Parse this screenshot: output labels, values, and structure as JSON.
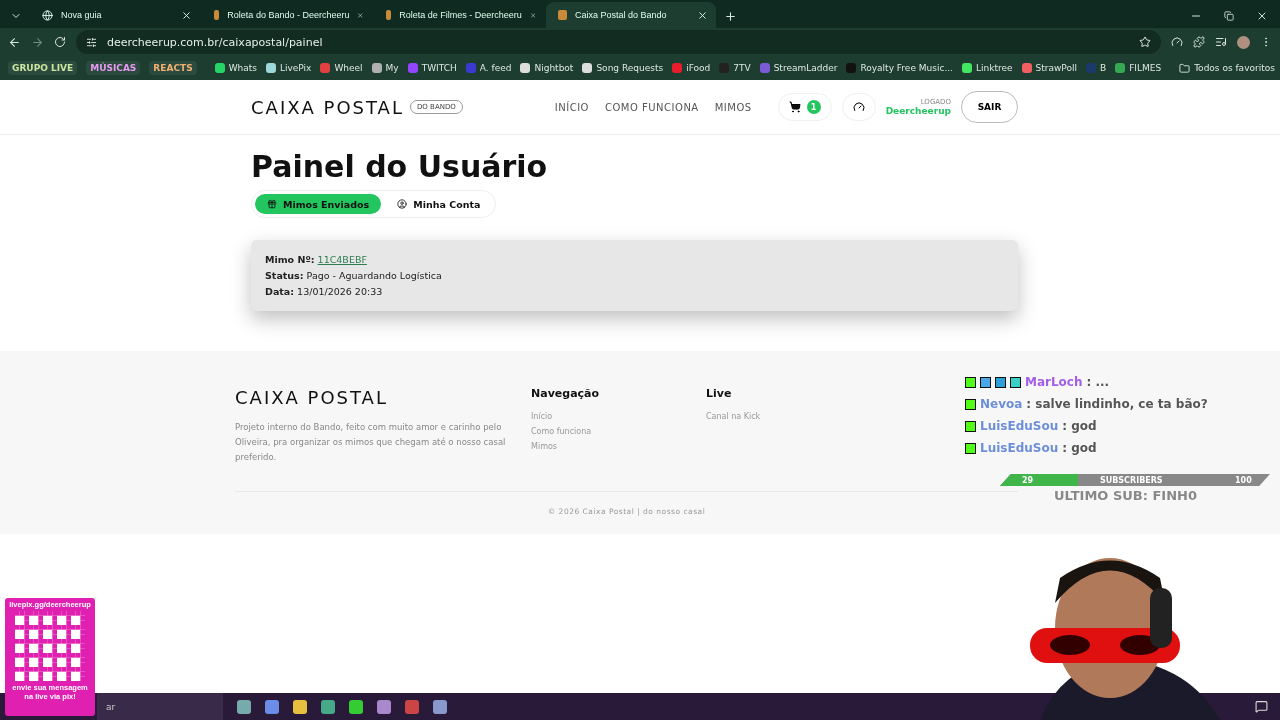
{
  "browser": {
    "tabs": [
      {
        "title": "Nova guia",
        "kind": "newtab",
        "selected": false
      },
      {
        "title": "Roleta do Bando - Deercheeru",
        "kind": "site",
        "selected": false
      },
      {
        "title": "Roleta de Filmes - Deercheeru",
        "kind": "site",
        "selected": false
      },
      {
        "title": "Caixa Postal do Bando",
        "kind": "site",
        "selected": true
      }
    ],
    "url": "deercheerup.com.br/caixapostal/painel",
    "bookmarks": [
      {
        "label": "GRUPO LIVE",
        "kind": "chip",
        "color": "#c8e6a0"
      },
      {
        "label": "MÚSICAS",
        "kind": "chip",
        "color": "#e59af0"
      },
      {
        "label": "REACTS",
        "kind": "chip",
        "color": "#f0b070"
      },
      {
        "label": "Whats",
        "kind": "link",
        "color": "#25d366"
      },
      {
        "label": "LivePix",
        "kind": "link",
        "color": "#9fd8d8"
      },
      {
        "label": "Wheel",
        "kind": "link",
        "color": "#e04040"
      },
      {
        "label": "My",
        "kind": "link",
        "color": "#b0b0b0"
      },
      {
        "label": "TWITCH",
        "kind": "link",
        "color": "#9146ff"
      },
      {
        "label": "A. feed",
        "kind": "link",
        "color": "#3a3ad0"
      },
      {
        "label": "Nightbot",
        "kind": "link",
        "color": "#dddddd"
      },
      {
        "label": "Song Requests",
        "kind": "link",
        "color": "#dddddd"
      },
      {
        "label": "iFood",
        "kind": "link",
        "color": "#ea1d2c"
      },
      {
        "label": "7TV",
        "kind": "link",
        "color": "#222222"
      },
      {
        "label": "StreamLadder",
        "kind": "link",
        "color": "#7b5cd6"
      },
      {
        "label": "Royalty Free Music...",
        "kind": "link",
        "color": "#111111"
      },
      {
        "label": "Linktree",
        "kind": "link",
        "color": "#43e660"
      },
      {
        "label": "StrawPoll",
        "kind": "link",
        "color": "#f06060"
      },
      {
        "label": "B",
        "kind": "link",
        "color": "#1a3a6a"
      },
      {
        "label": "FILMES",
        "kind": "link",
        "color": "#34a853"
      }
    ],
    "all_bookmarks": "Todos os favoritos"
  },
  "header": {
    "brand": "CAIXA POSTAL",
    "brand_badge": "DO BANDO",
    "nav": [
      "INÍCIO",
      "COMO FUNCIONA",
      "MIMOS"
    ],
    "cart_count": "1",
    "logged_label": "LOGADO",
    "user": "Deercheerup",
    "logout": "SAIR"
  },
  "page": {
    "title": "Painel do Usuário",
    "tabs": [
      {
        "label": "Mimos Enviados",
        "kind": "gifts",
        "selected": true
      },
      {
        "label": "Minha Conta",
        "kind": "account",
        "selected": false
      }
    ],
    "order": {
      "number_label": "Mimo Nº:",
      "number": "11C4BEBF",
      "status_label": "Status:",
      "status": "Pago - Aguardando Logística",
      "date_label": "Data:",
      "date": "13/01/2026 20:33"
    }
  },
  "footer": {
    "brand": "CAIXA POSTAL",
    "about": "Projeto interno do Bando, feito com muito amor e carinho pelo Oliveira, pra organizar os mimos que chegam até o nosso casal preferido.",
    "columns": [
      {
        "title": "Navegação",
        "links": [
          "Início",
          "Como funciona",
          "Mimos"
        ]
      },
      {
        "title": "Live",
        "links": [
          "Canal na Kick"
        ]
      }
    ],
    "copyright": "© 2026 Caixa Postal | do nosso casal"
  },
  "stream_overlay": {
    "chat": [
      {
        "user": "MarLoch",
        "text": ": ...",
        "color": "#a25ee8",
        "badges": [
          {
            "color": "#53fc18"
          },
          {
            "color": "#4aa8e8"
          },
          {
            "color": "#2a9fd8"
          },
          {
            "color": "#3ad0c8"
          }
        ]
      },
      {
        "user": "Nevoa",
        "text": ": salve lindinho, ce ta bão?",
        "color": "#6c8ed8",
        "badges": [
          {
            "color": "#53fc18"
          }
        ]
      },
      {
        "user": "LuisEduSou",
        "text": ": god",
        "color": "#6c8ed8",
        "badges": [
          {
            "color": "#53fc18"
          }
        ]
      },
      {
        "user": "LuisEduSou",
        "text": ": god",
        "color": "#6c8ed8",
        "badges": [
          {
            "color": "#53fc18"
          }
        ]
      }
    ],
    "subs": {
      "current": "29",
      "label": "SUBSCRIBERS",
      "goal": "100",
      "level": 0.29
    },
    "last_sub": "ULTIMO SUB: FINH0",
    "qr": {
      "top": "livepix.gg/deercheerup",
      "bottom": "envie sua mensagem na live via pix!"
    }
  },
  "taskbar": {
    "search": "ar"
  }
}
